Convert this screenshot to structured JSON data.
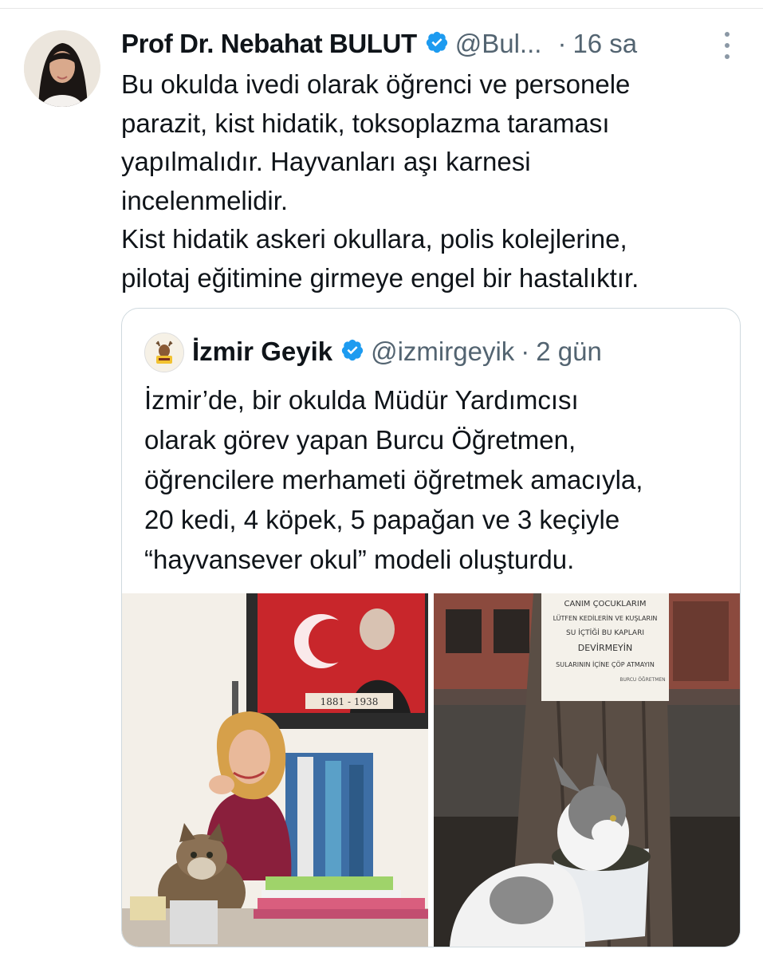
{
  "tweet": {
    "author_name": "Prof Dr. Nebahat BULUT",
    "handle": "@Bul...",
    "separator": "·",
    "time": "16 sa",
    "text_lines": [
      "Bu okulda ivedi olarak öğrenci ve personele",
      "parazit, kist hidatik, toksoplazma taraması",
      "yapılmalıdır. Hayvanları aşı karnesi",
      "incelenmelidir.",
      "Kist hidatik askeri okullara, polis kolejlerine,",
      "pilotaj eğitimine girmeye engel bir hastalıktır."
    ]
  },
  "quote": {
    "author_name": "İzmir Geyik",
    "handle": "@izmirgeyik",
    "separator": "·",
    "time": "2 gün",
    "text_lines": [
      "İzmir’de, bir okulda Müdür Yardımcısı",
      "olarak görev yapan Burcu Öğretmen,",
      "öğrencilere merhameti öğretmek amacıyla,",
      "20 kedi, 4 köpek, 5 papağan ve 3 keçiyle",
      "“hayvansever okul” modeli oluşturdu."
    ],
    "photo_right_sign_lines": [
      "CANIM ÇOCUKLARIM",
      "LÜTFEN KEDİLERİN VE KUŞLARIN",
      "SU İÇTİĞİ BU KAPLARI",
      "DEVİRMEYİN",
      "SULARININ İÇİNE ÇÖP ATMAYIN",
      "BURCU ÖĞRETMEN"
    ],
    "photo_left_frame_years": "1881 - 1938"
  },
  "colors": {
    "verified": "#1d9bf0",
    "secondary_text": "#536471",
    "border": "#cfd9de"
  },
  "icons": {
    "verified": "verified-badge-icon",
    "more": "more-dots-icon"
  }
}
